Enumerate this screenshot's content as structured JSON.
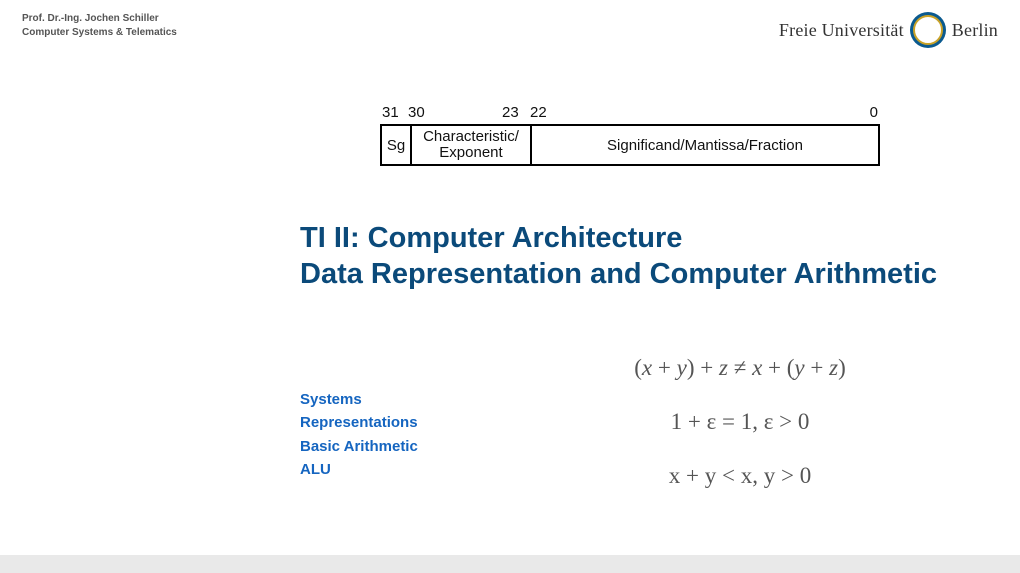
{
  "header": {
    "author": "Prof. Dr.-Ing. Jochen Schiller",
    "dept": "Computer Systems & Telematics",
    "uni_prefix": "Freie Universität",
    "uni_suffix": "Berlin"
  },
  "bitfield": {
    "labels": {
      "b31": "31",
      "b30": "30",
      "b23": "23",
      "b22": "22",
      "b0": "0"
    },
    "sg": "Sg",
    "exp_top": "Characteristic/",
    "exp_bot": "Exponent",
    "mant": "Significand/Mantissa/Fraction"
  },
  "title": {
    "line1": "TI II: Computer Architecture",
    "line2": "Data Representation and Computer Arithmetic"
  },
  "topics": {
    "t1": "Systems",
    "t2": "Representations",
    "t3": "Basic Arithmetic",
    "t4": "ALU"
  },
  "equations": {
    "e1_a": "(",
    "e1_b": "x",
    "e1_c": " + ",
    "e1_d": "y",
    "e1_e": ") + ",
    "e1_f": "z",
    "e1_g": " ≠ ",
    "e1_h": "x",
    "e1_i": " + (",
    "e1_j": "y",
    "e1_k": " + ",
    "e1_l": "z",
    "e1_m": ")",
    "e2": "1 + ε = 1, ε > 0",
    "e3": "x + y < x, y > 0"
  }
}
